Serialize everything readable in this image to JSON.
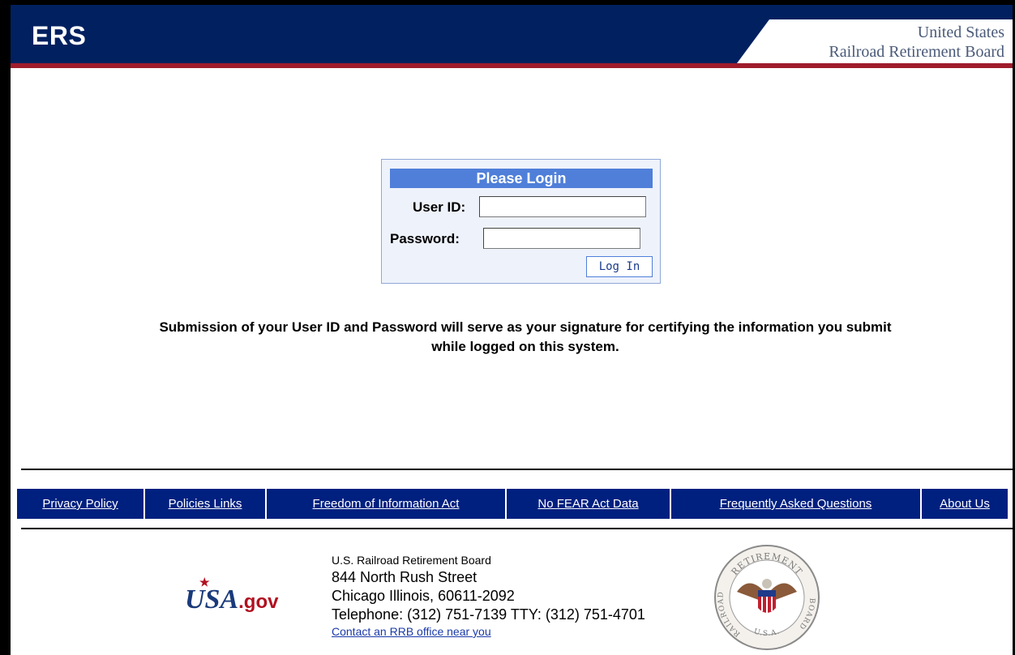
{
  "header": {
    "app_title": "ERS",
    "agency_line1": "United States",
    "agency_line2": "Railroad Retirement Board"
  },
  "login": {
    "heading": "Please Login",
    "user_id_label": "User ID:",
    "user_id_value": "",
    "password_label": "Password:",
    "password_value": "",
    "submit_label": "Log In"
  },
  "notice": {
    "line1": "Submission of your User ID and Password will serve as your signature for certifying the information you submit",
    "line2": "while logged on this system."
  },
  "nav": {
    "items": [
      {
        "label": "Privacy Policy"
      },
      {
        "label": "Policies Links"
      },
      {
        "label": "Freedom of Information Act"
      },
      {
        "label": "No FEAR Act Data"
      },
      {
        "label": "Frequently Asked Questions"
      },
      {
        "label": "About Us"
      }
    ]
  },
  "footer": {
    "usa_logo_main": "USA",
    "usa_logo_suffix": ".gov",
    "org": "U.S. Railroad Retirement Board",
    "street": "844 North Rush Street",
    "city": "Chicago Illinois, 60611-2092",
    "phone": "Telephone: (312) 751-7139 TTY: (312) 751-4701",
    "contact_link": "Contact an RRB office near you",
    "seal_text_top": "RETIREMENT",
    "seal_text_left": "RAILROAD",
    "seal_text_right": "BOARD",
    "seal_text_bottom": "U.S.A."
  },
  "colors": {
    "header_navy": "#002060",
    "header_red": "#a01c2c",
    "login_header": "#4f7fd9",
    "nav_blue": "#002080"
  }
}
